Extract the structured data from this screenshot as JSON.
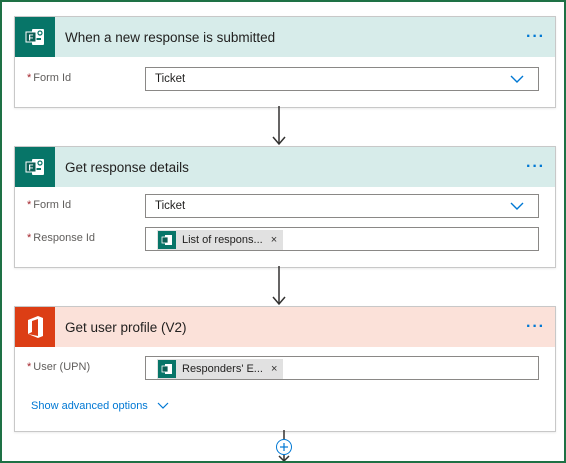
{
  "cards": [
    {
      "title": "When a new response is submitted",
      "more": "···",
      "fields": [
        {
          "required": "*",
          "label": "Form Id",
          "value": "Ticket"
        }
      ]
    },
    {
      "title": "Get response details",
      "more": "···",
      "fields": [
        {
          "required": "*",
          "label": "Form Id",
          "value": "Ticket"
        },
        {
          "required": "*",
          "label": "Response Id",
          "token": "List of respons...",
          "token_remove": "×"
        }
      ]
    },
    {
      "title": "Get user profile (V2)",
      "more": "···",
      "fields": [
        {
          "required": "*",
          "label": "User (UPN)",
          "token": "Responders' E...",
          "token_remove": "×"
        }
      ],
      "advanced": "Show advanced options"
    }
  ],
  "colors": {
    "forms_brand": "#077568",
    "office_brand": "#dc3e15",
    "forms_header": "#d7ecea",
    "office_header": "#fbe1d9",
    "link": "#0078d4"
  },
  "icons": [
    "forms-logo-icon",
    "office-logo-icon",
    "chevron-down-icon",
    "more-options-icon",
    "arrow-down-icon",
    "add-step-icon"
  ]
}
